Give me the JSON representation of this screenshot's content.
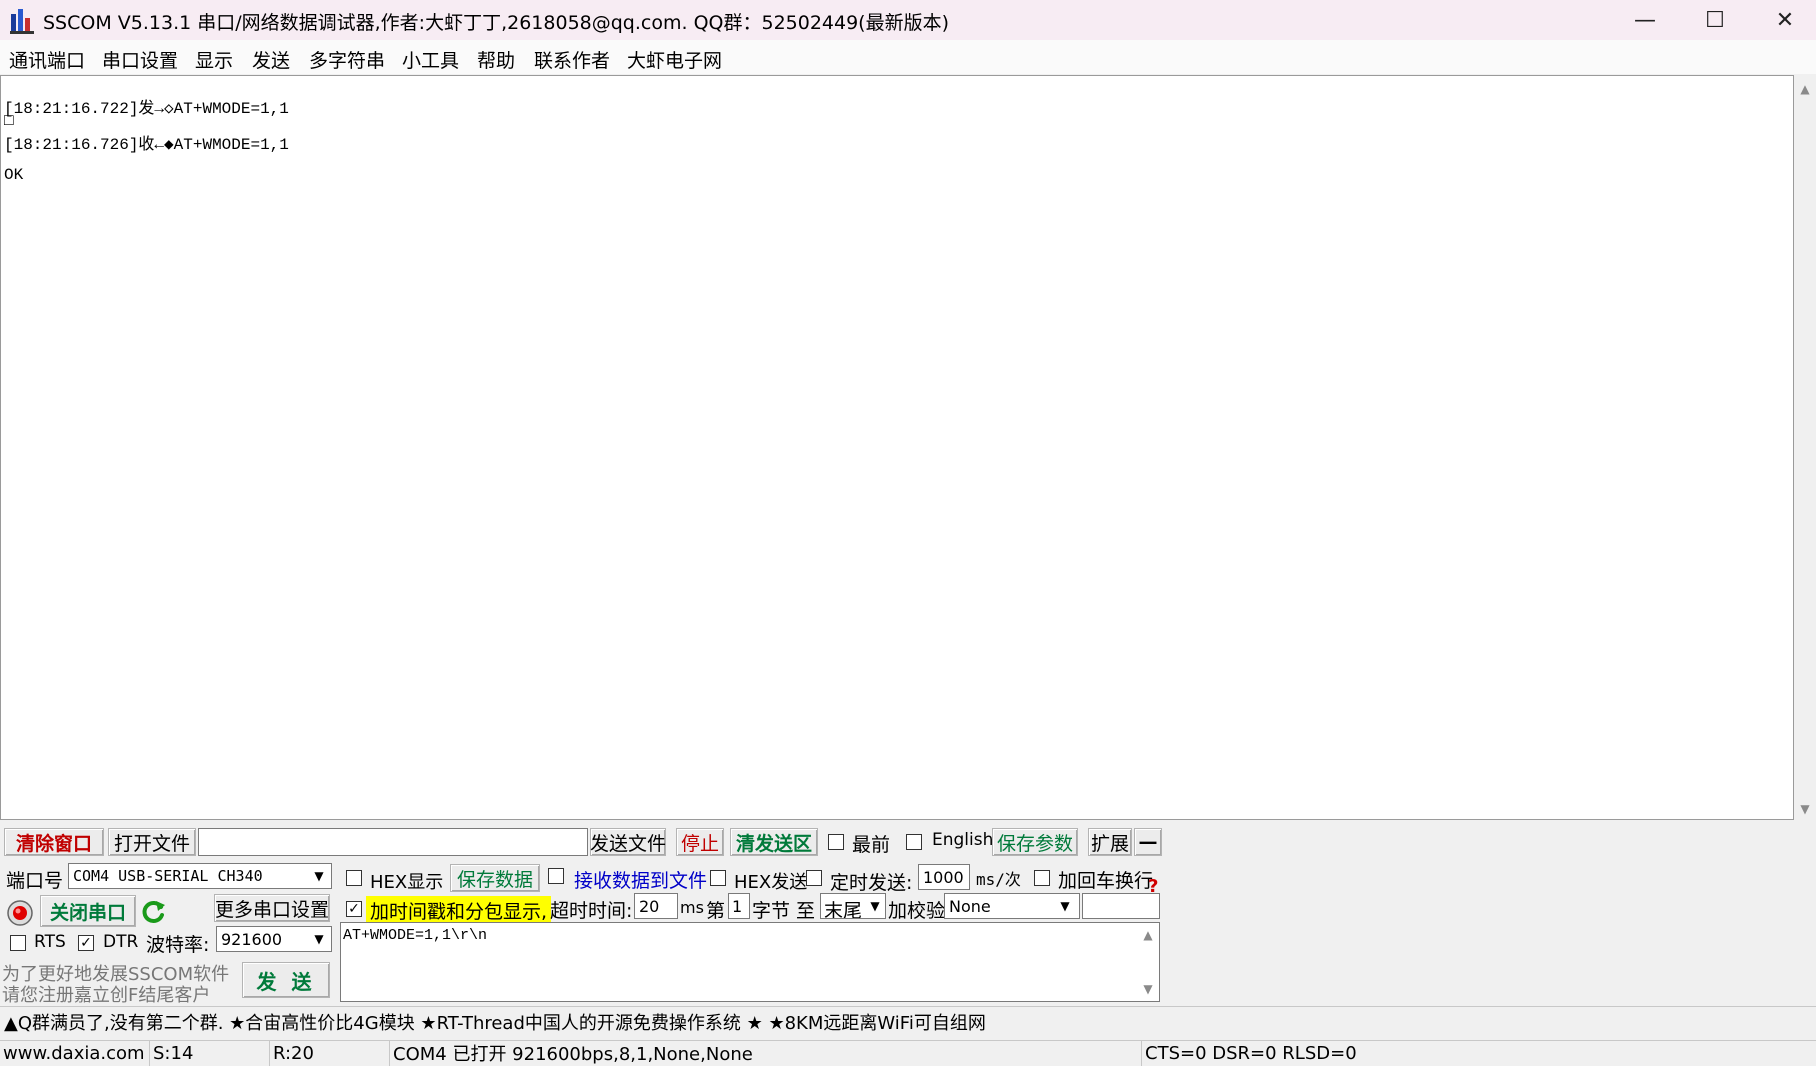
{
  "window": {
    "title": "SSCOM V5.13.1 串口/网络数据调试器,作者:大虾丁丁,2618058@qq.com. QQ群：52502449(最新版本)",
    "minimize": "—",
    "maximize": "☐",
    "close": "✕"
  },
  "menu": [
    "通讯端口",
    "串口设置",
    "显示",
    "发送",
    "多字符串",
    "小工具",
    "帮助",
    "联系作者",
    "大虾电子网"
  ],
  "receive": {
    "lines": [
      "[18:21:16.722]发→◇AT+WMODE=1,1",
      "□",
      "[18:21:16.726]收←◆AT+WMODE=1,1",
      "",
      "OK"
    ]
  },
  "toolbar": {
    "clear_window": "清除窗口",
    "open_file": "打开文件",
    "file_path": "",
    "send_file": "发送文件",
    "stop": "停止",
    "clear_send": "清发送区",
    "topmost": "最前",
    "english": "English",
    "save_params": "保存参数",
    "expand": "扩展",
    "collapse": "—"
  },
  "port": {
    "port_label": "端口号",
    "port_value": "COM4 USB-SERIAL CH340",
    "close_port": "关闭串口",
    "more_settings": "更多串口设置",
    "rts": "RTS",
    "dtr": "DTR",
    "baud_label": "波特率:",
    "baud_value": "921600"
  },
  "options": {
    "hex_display": "HEX显示",
    "save_data": "保存数据",
    "recv_to_file": "接收数据到文件",
    "hex_send": "HEX发送",
    "timed_send": "定时发送:",
    "interval": "1000",
    "interval_unit": "ms/次",
    "add_crlf": "加回车换行",
    "timestamp": "加时间戳和分包显示,",
    "timeout_label": "超时时间:",
    "timeout_value": "20",
    "timeout_unit": "ms",
    "byte_from_label": "第",
    "byte_from": "1",
    "byte_unit": "字节 至",
    "byte_to": "末尾",
    "checksum_label": "加校验",
    "checksum_value": "None",
    "help_mark": "?"
  },
  "send": {
    "text": "AT+WMODE=1,1\\r\\n",
    "button": "发 送"
  },
  "promo": {
    "line1": "为了更好地发展SSCOM软件",
    "line2": "请您注册嘉立创F结尾客户"
  },
  "ticker": "▲Q群满员了,没有第二个群. ★合宙高性价比4G模块 ★RT-Thread中国人的开源免费操作系统 ★ ★8KM远距离WiFi可自组网",
  "statusbar": {
    "site": "www.daxia.com",
    "sent": "S:14",
    "recv": "R:20",
    "port_status": "COM4 已打开  921600bps,8,1,None,None",
    "lines": "CTS=0 DSR=0 RLSD=0"
  },
  "colors": {
    "accent_red": "#c00000",
    "accent_green": "#007a3a",
    "accent_blue": "#0000c8",
    "highlight_yellow": "#ffff00"
  }
}
